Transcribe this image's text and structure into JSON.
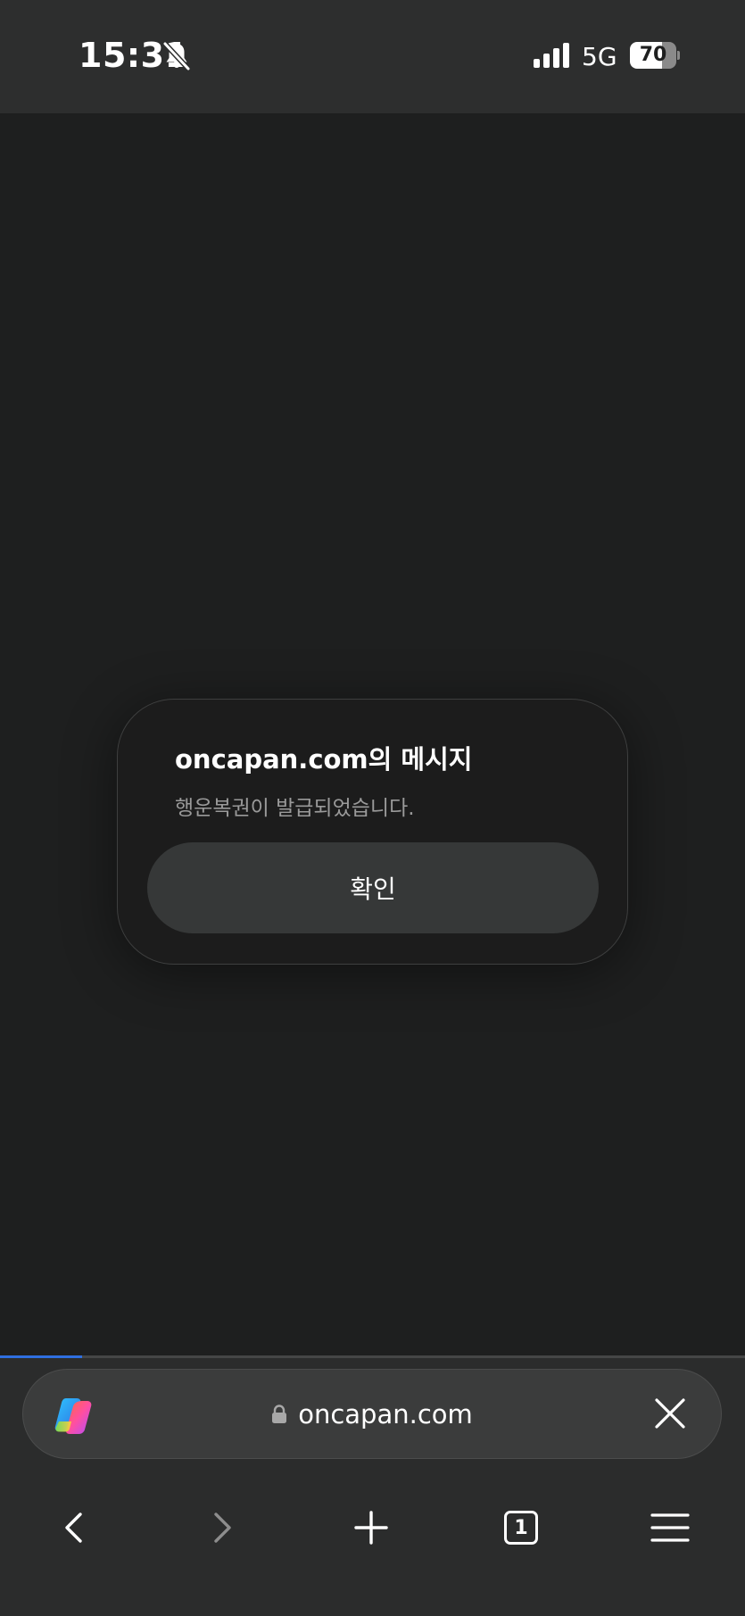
{
  "status_bar": {
    "time": "15:31",
    "network": "5G",
    "battery_level": "70",
    "battery_fraction": 0.7,
    "icons": [
      "bell-muted-icon",
      "signal-icon",
      "battery-icon"
    ]
  },
  "dialog": {
    "title": "oncapan.com의 메시지",
    "message": "행운복권이 발급되었습니다.",
    "confirm_label": "확인"
  },
  "browser": {
    "url": "oncapan.com",
    "load_progress": 0.11,
    "tab_count": "1",
    "icons": [
      "copilot-icon",
      "lock-icon",
      "close-icon",
      "back-icon",
      "forward-icon",
      "new-tab-icon",
      "tabs-icon",
      "menu-icon"
    ]
  },
  "colors": {
    "page_background": "#1e1f1f",
    "chrome_background": "#2b2c2c",
    "progress_accent": "#2f6fe0",
    "dialog_button": "#363838"
  }
}
